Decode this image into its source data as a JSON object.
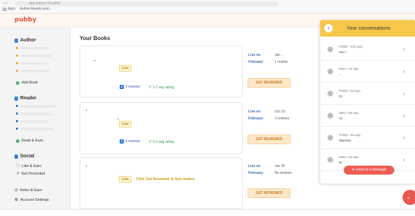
{
  "browser": {
    "address": "app.pubby.co/author",
    "bookmarks": [
      "Apps",
      "Author Awards and..."
    ]
  },
  "app": {
    "logo": "pubby"
  },
  "sidebar": {
    "author": {
      "title": "Author",
      "add_book": "Add Book"
    },
    "reader": {
      "title": "Reader",
      "read_earn": "Read & Earn"
    },
    "social": {
      "title": "Social",
      "like_earn": "Like & Earn",
      "get_promoted": "Get Promoted"
    },
    "refer": "Refer & Earn",
    "settings": "Account Settings"
  },
  "main": {
    "title": "Your Books",
    "books": [
      {
        "status": "Live",
        "reviews": "3 reviews",
        "rating": "3.7 avg rating",
        "live_on_label": "Live on",
        "live_on_value": "Jan ...",
        "month": "February",
        "month_value": "1 review",
        "button": "GET REVIEWED"
      },
      {
        "status": "Live",
        "reviews": "4 reviews",
        "rating": "5.0 avg rating",
        "live_on_label": "Live on",
        "live_on_value": "Oct 19",
        "month": "February",
        "month_value": "2 reviews",
        "button": "GET REVIEWED"
      },
      {
        "status": "Live",
        "hint": "Click 'Get Reviewed' to find readers",
        "live_on_label": "Live on",
        "live_on_value": "Jan 20",
        "month": "February",
        "month_value": "No reviews",
        "button": "GET REVIEWED"
      }
    ]
  },
  "conversations": {
    "title": "Your conversations",
    "items": [
      {
        "name": "Pubby",
        "time": "23m ago",
        "message": "You: i"
      },
      {
        "name": "Mary",
        "time": "4w ago",
        "message": "..."
      },
      {
        "name": "Pubby",
        "time": "5w ago",
        "message": "Oi"
      },
      {
        "name": "Mary",
        "time": "8w ago",
        "message": "Yo"
      },
      {
        "name": "Pubby",
        "time": "8w ago",
        "message": "Operator"
      },
      {
        "name": "Mary",
        "time": "8w ago",
        "message": "Hi"
      }
    ],
    "send_button": "Send us a message"
  },
  "colors": {
    "brand": "#e0523f",
    "accent": "#f6c84a",
    "link": "#2f6db8"
  }
}
